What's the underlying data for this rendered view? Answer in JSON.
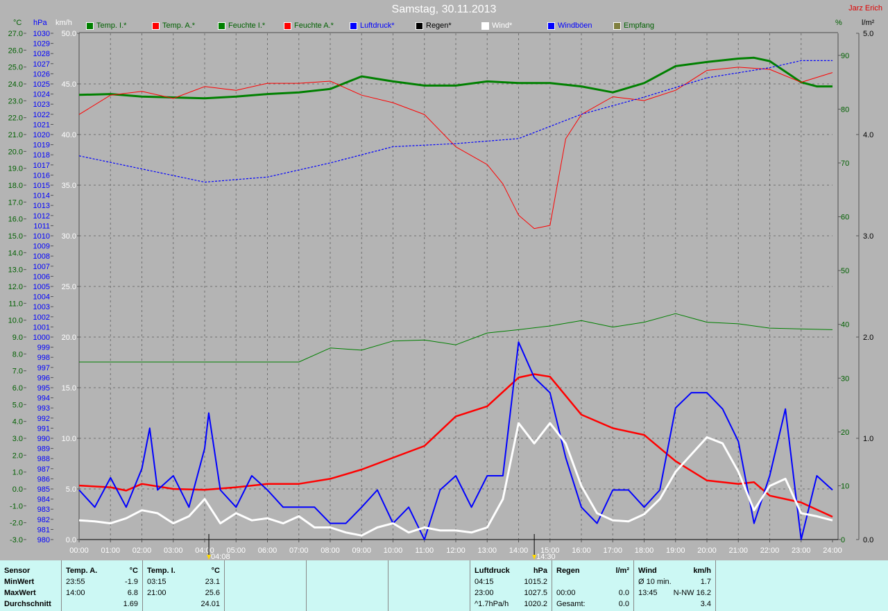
{
  "title": "Samstag, 30.11.2013",
  "author": "Jarz Erich",
  "legend": [
    {
      "label": "Temp. I.*",
      "color": "#008000",
      "text": "#006000"
    },
    {
      "label": "Temp. A.*",
      "color": "#ff0000",
      "text": "#006000"
    },
    {
      "label": "Feuchte I.*",
      "color": "#008000",
      "text": "#006000"
    },
    {
      "label": "Feuchte A.*",
      "color": "#ff0000",
      "text": "#006000"
    },
    {
      "label": "Luftdruck*",
      "color": "#0000ff",
      "text": "#0000ff"
    },
    {
      "label": "Regen*",
      "color": "#000000",
      "text": "#000000"
    },
    {
      "label": "Wind*",
      "color": "#ffffff",
      "text": "#ffffff"
    },
    {
      "label": "Windböen",
      "color": "#0000ff",
      "text": "#0000ff"
    },
    {
      "label": "Empfang",
      "color": "#808040",
      "text": "#006000"
    }
  ],
  "units": {
    "temp": "°C",
    "pressure": "hPa",
    "wind": "km/h",
    "humidity": "%",
    "rain": "l/m²"
  },
  "markers": [
    "04:08",
    "14:30"
  ],
  "chart_data": {
    "type": "line",
    "title": "Samstag, 30.11.2013",
    "x_unit": "hours",
    "xlim": [
      0,
      24
    ],
    "x_ticks": [
      "00:00",
      "01:00",
      "02:00",
      "03:00",
      "04:00",
      "05:00",
      "06:00",
      "07:00",
      "08:00",
      "09:00",
      "10:00",
      "11:00",
      "12:00",
      "13:00",
      "14:00",
      "15:00",
      "16:00",
      "17:00",
      "18:00",
      "19:00",
      "20:00",
      "21:00",
      "22:00",
      "23:00",
      "24:00"
    ],
    "axes": {
      "temp": {
        "range": [
          -3,
          27
        ],
        "step": 1,
        "decimals": 1,
        "color": "#006000"
      },
      "pressure": {
        "range": [
          980,
          1030
        ],
        "step": 1,
        "decimals": 0,
        "color": "#0000ff"
      },
      "wind": {
        "range": [
          0,
          50
        ],
        "step": 5,
        "decimals": 1,
        "color": "#ffffff"
      },
      "humidity": {
        "range": [
          0,
          94.1
        ],
        "ticks": [
          0,
          10,
          20,
          30,
          40,
          50,
          60,
          70,
          80,
          90
        ],
        "color": "#006000"
      },
      "rain": {
        "range": [
          0,
          5
        ],
        "ticks": [
          0,
          1,
          2,
          3,
          4,
          5
        ],
        "decimals": 1,
        "color": "#000000"
      }
    },
    "grid": true,
    "series": [
      {
        "name": "Temp. I.",
        "axis": "temp",
        "color": "#008000",
        "width": 3,
        "x": [
          0,
          1,
          2,
          3,
          4,
          5,
          6,
          7,
          8,
          9,
          10,
          11,
          12,
          13,
          14,
          15,
          16,
          17,
          18,
          19,
          20,
          21,
          21.5,
          22,
          23,
          23.5,
          24
        ],
        "y": [
          23.35,
          23.4,
          23.25,
          23.2,
          23.15,
          23.25,
          23.4,
          23.5,
          23.7,
          24.45,
          24.15,
          23.9,
          23.9,
          24.15,
          24.05,
          24.05,
          23.85,
          23.5,
          24.05,
          25.05,
          25.3,
          25.5,
          25.55,
          25.35,
          24.1,
          23.85,
          23.85
        ]
      },
      {
        "name": "Temp. A.",
        "axis": "temp",
        "color": "#ff0000",
        "width": 2.5,
        "x": [
          0,
          1,
          1.5,
          2,
          3,
          4,
          5,
          6,
          7,
          8,
          9,
          10,
          11,
          12,
          13,
          14,
          14.5,
          15,
          16,
          17,
          18,
          19,
          20,
          21,
          21.5,
          22,
          23,
          24
        ],
        "y": [
          0.2,
          0.1,
          -0.1,
          0.3,
          0.0,
          -0.05,
          0.1,
          0.3,
          0.3,
          0.6,
          1.15,
          1.85,
          2.55,
          4.3,
          4.9,
          6.6,
          6.8,
          6.65,
          4.4,
          3.6,
          3.2,
          1.65,
          0.5,
          0.3,
          0.4,
          -0.4,
          -0.8,
          -1.65
        ]
      },
      {
        "name": "Feuchte I.",
        "axis": "humidity",
        "color": "#008000",
        "width": 1,
        "x": [
          0,
          7,
          8,
          9,
          10,
          11,
          12,
          13,
          14,
          15,
          16,
          17,
          18,
          19,
          20,
          21,
          22,
          24
        ],
        "y": [
          33,
          33,
          35.6,
          35.2,
          36.9,
          37.1,
          36.2,
          38.4,
          39,
          39.7,
          40.7,
          39.5,
          40.4,
          42,
          40.4,
          40.1,
          39.3,
          39
        ]
      },
      {
        "name": "Feuchte A.",
        "axis": "humidity",
        "color": "#ff0000",
        "width": 1,
        "x": [
          0,
          1,
          2,
          3,
          4,
          5,
          6,
          7,
          8,
          9,
          10,
          11,
          12,
          13,
          13.5,
          14,
          14.5,
          15,
          15.5,
          16,
          17,
          18,
          19,
          20,
          21,
          22,
          23,
          24
        ],
        "y": [
          79,
          82.6,
          83.3,
          82,
          84.2,
          83.5,
          84.8,
          84.8,
          85.2,
          82.6,
          81.2,
          79,
          73,
          69.7,
          66.1,
          60.3,
          57.8,
          58.4,
          74.5,
          79,
          82.3,
          81.6,
          83.5,
          87.2,
          87.8,
          87.4,
          85,
          86.8
        ]
      },
      {
        "name": "Luftdruck",
        "axis": "pressure",
        "color": "#0000ff",
        "width": 1.2,
        "dashed": true,
        "x": [
          0,
          2,
          4,
          6,
          8,
          10,
          12,
          14,
          15,
          16,
          18,
          20,
          22,
          23,
          24
        ],
        "y": [
          1017.9,
          1016.6,
          1015.3,
          1015.8,
          1017.2,
          1018.8,
          1019.1,
          1019.6,
          1020.8,
          1022,
          1023.7,
          1025.6,
          1026.6,
          1027.3,
          1027.3
        ]
      },
      {
        "name": "Windböen",
        "axis": "wind",
        "color": "#0000ff",
        "width": 2,
        "x": [
          0,
          0.5,
          1,
          1.5,
          2,
          2.25,
          2.5,
          3,
          3.5,
          4,
          4.13,
          4.5,
          5,
          5.5,
          6,
          6.5,
          7,
          7.5,
          8,
          8.5,
          9,
          9.5,
          10,
          10.5,
          11,
          11.5,
          12,
          12.5,
          13,
          13.5,
          14,
          14.5,
          15,
          15.5,
          16,
          16.5,
          17,
          17.5,
          18,
          18.5,
          19,
          19.5,
          20,
          20.5,
          21,
          21.5,
          22,
          22.5,
          23,
          23.5,
          24
        ],
        "y": [
          4.9,
          3.2,
          6.1,
          3.2,
          7,
          11,
          4.9,
          6.3,
          3.2,
          9,
          12.5,
          4.9,
          3.2,
          6.3,
          4.9,
          3.2,
          3.2,
          3.2,
          1.6,
          1.6,
          3.2,
          4.9,
          1.6,
          3.2,
          0,
          4.9,
          6.3,
          3.2,
          6.3,
          6.3,
          19.5,
          16,
          14.5,
          8.1,
          3.2,
          1.6,
          4.9,
          4.9,
          3.2,
          4.9,
          13,
          14.5,
          14.5,
          12.9,
          9.7,
          1.6,
          6.3,
          12.9,
          0,
          6.3,
          4.9
        ]
      },
      {
        "name": "Wind",
        "axis": "wind",
        "color": "#ffffff",
        "width": 3,
        "x": [
          0,
          0.5,
          1,
          1.5,
          2,
          2.5,
          3,
          3.5,
          4,
          4.5,
          5,
          5.5,
          6,
          6.5,
          7,
          7.5,
          8,
          8.5,
          9,
          9.5,
          10,
          10.5,
          11,
          11.5,
          12,
          12.5,
          13,
          13.5,
          14,
          14.5,
          15,
          15.5,
          16,
          16.5,
          17,
          17.5,
          18,
          18.5,
          19,
          19.5,
          20,
          20.5,
          21,
          21.5,
          22,
          22.5,
          23,
          23.5,
          24
        ],
        "y": [
          1.9,
          1.8,
          1.6,
          2.1,
          2.9,
          2.6,
          1.6,
          2.3,
          4,
          1.6,
          2.6,
          1.9,
          2.1,
          1.6,
          2.3,
          1.2,
          1.2,
          0.7,
          0.4,
          1.2,
          1.6,
          0.7,
          1.2,
          0.9,
          0.9,
          0.7,
          1.2,
          4,
          11.5,
          9.5,
          11.5,
          9.5,
          5.3,
          2.6,
          1.9,
          1.8,
          2.5,
          4,
          6.7,
          8.4,
          10.1,
          9.5,
          6.7,
          2.9,
          5.3,
          6,
          2.6,
          2.3,
          1.9
        ]
      }
    ]
  },
  "stats": {
    "sensor": {
      "header": "Sensor",
      "rows": [
        "MinWert",
        "MaxWert",
        "Durchschnitt"
      ]
    },
    "temp_a": {
      "header": "Temp. A.",
      "unit": "°C",
      "min_time": "23:55",
      "min": "-1.9",
      "max_time": "14:00",
      "max": "6.8",
      "avg": "1.69"
    },
    "temp_i": {
      "header": "Temp. I.",
      "unit": "°C",
      "min_time": "03:15",
      "min": "23.1",
      "max_time": "21:00",
      "max": "25.6",
      "avg": "24.01"
    },
    "pressure": {
      "header": "Luftdruck",
      "unit": "hPa",
      "min_time": "04:15",
      "min": "1015.2",
      "max_time": "23:00",
      "max": "1027.5",
      "trend": "^1.7hPa/h",
      "avg": "1020.2"
    },
    "rain": {
      "header": "Regen",
      "unit": "l/m²",
      "time": "00:00",
      "value": "0.0",
      "total_label": "Gesamt:",
      "total": "0.0"
    },
    "wind": {
      "header": "Wind",
      "unit": "km/h",
      "avg_label": "Ø 10 min.",
      "avg": "1.7",
      "max_time": "13:45",
      "max": "N-NW 16.2",
      "day_avg": "3.4"
    }
  }
}
